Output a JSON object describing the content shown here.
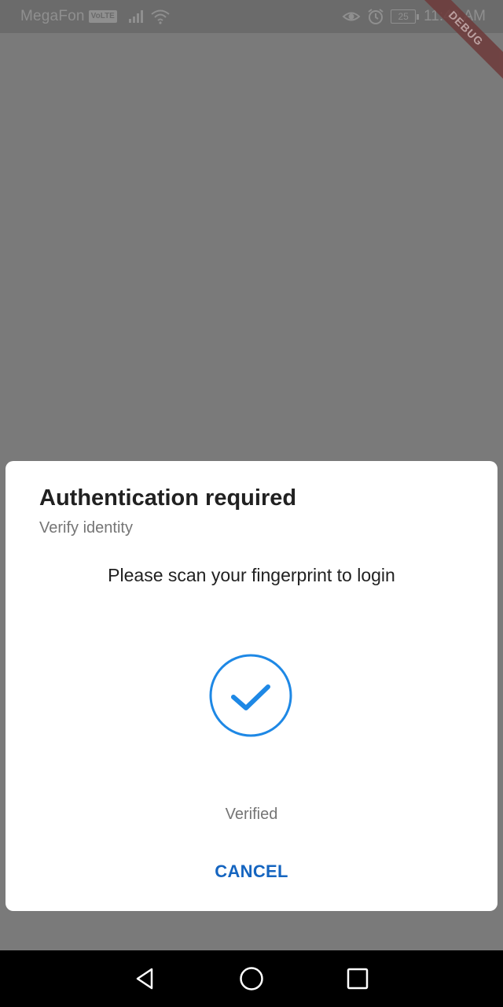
{
  "status_bar": {
    "carrier": "MegaFon",
    "network_badge": "VoLTE",
    "battery_level": "25",
    "time": "11:49 AM",
    "icons": [
      "signal-icon",
      "wifi-icon",
      "eye-comfort-icon",
      "alarm-icon",
      "battery-icon"
    ]
  },
  "debug_banner": "DEBUG",
  "dialog": {
    "title": "Authentication required",
    "subtitle": "Verify identity",
    "description": "Please scan your fingerprint to login",
    "status_icon": "check-circle-icon",
    "status_text": "Verified",
    "cancel_label": "CANCEL"
  },
  "colors": {
    "accent": "#1e88e5",
    "cancel_text": "#1565c0",
    "scrim": "#7a7a7a",
    "dialog_bg": "#ffffff"
  },
  "nav_bar": {
    "buttons": [
      "back-icon",
      "home-icon",
      "recents-icon"
    ]
  }
}
